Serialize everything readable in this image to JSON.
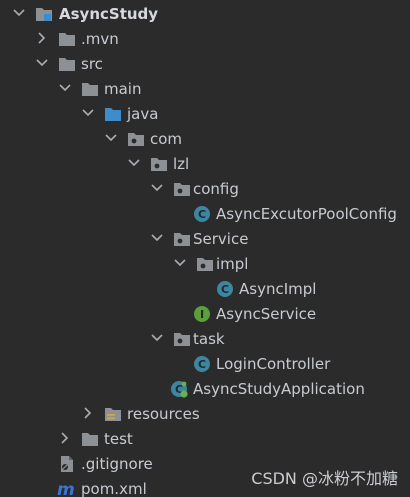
{
  "project": {
    "root": "AsyncStudy"
  },
  "tree": {
    "mvn": ".mvn",
    "src": "src",
    "main": "main",
    "java": "java",
    "com": "com",
    "lzl": "lzl",
    "config": "config",
    "async_executor_pool_config": "AsyncExcutorPoolConfig",
    "service": "Service",
    "impl": "impl",
    "async_impl": "AsyncImpl",
    "async_service": "AsyncService",
    "task": "task",
    "login_controller": "LoginController",
    "async_study_application": "AsyncStudyApplication",
    "resources": "resources",
    "test": "test",
    "gitignore": ".gitignore",
    "pom": "pom.xml"
  },
  "watermark": "CSDN @冰粉不加糖",
  "colors": {
    "background": "#2b2b2b",
    "text": "#c7cbd1",
    "folder": "#8d9196",
    "source_folder": "#3f8ccb",
    "class_icon": "#3e86a0",
    "interface_icon": "#5b9e3a",
    "maven_icon": "#3b74d9"
  }
}
